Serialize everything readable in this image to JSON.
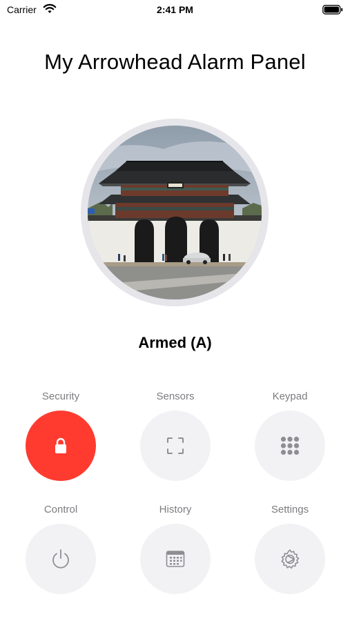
{
  "status_bar": {
    "carrier": "Carrier",
    "time": "2:41 PM"
  },
  "title": "My Arrowhead Alarm Panel",
  "status": "Armed (A)",
  "colors": {
    "active": "#ff3b30",
    "tile_bg": "#f2f2f4",
    "label": "#7c7c80",
    "icon": "#8e8e93",
    "ring": "#e5e5ea"
  },
  "tiles": [
    {
      "label": "Security",
      "icon": "lock-icon",
      "active": true
    },
    {
      "label": "Sensors",
      "icon": "scan-frame-icon",
      "active": false
    },
    {
      "label": "Keypad",
      "icon": "keypad-grid-icon",
      "active": false
    },
    {
      "label": "Control",
      "icon": "power-icon",
      "active": false
    },
    {
      "label": "History",
      "icon": "calendar-icon",
      "active": false
    },
    {
      "label": "Settings",
      "icon": "gear-icon",
      "active": false
    }
  ]
}
